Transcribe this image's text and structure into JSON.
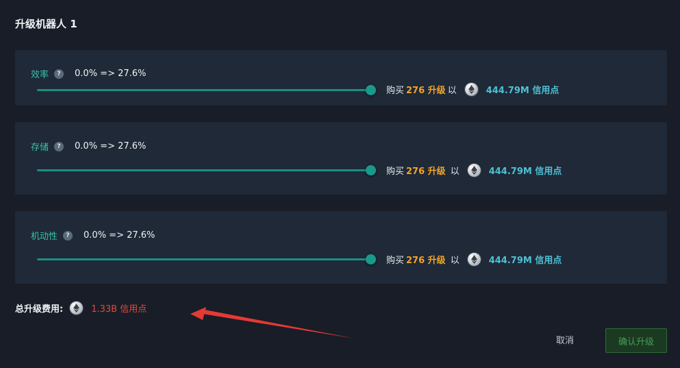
{
  "dialog": {
    "title": "升级机器人 1"
  },
  "upgrades": [
    {
      "name": "效率",
      "change": "0.0% => 27.6%",
      "buy_prefix": "购买",
      "qty": "276 升级",
      "buy_suffix": "以",
      "price": "444.79M 信用点",
      "level_fraction": 1.0
    },
    {
      "name": "存储",
      "change": "0.0% => 27.6%",
      "buy_prefix": "购买",
      "qty": "276 升级",
      "buy_suffix": "以",
      "price": "444.79M 信用点",
      "level_fraction": 1.0
    },
    {
      "name": "机动性",
      "change": "0.0% => 27.6%",
      "buy_prefix": "购买",
      "qty": "276 升级",
      "buy_suffix": "以",
      "price": "444.79M 信用点",
      "level_fraction": 1.0
    }
  ],
  "help_icon": {
    "glyph": "?"
  },
  "total": {
    "label": "总升级费用:",
    "value": "1.33B 信用点"
  },
  "actions": {
    "cancel": "取消",
    "confirm": "确认升级"
  },
  "colors": {
    "accent": "#1a9a8c",
    "qty": "#f3a42a",
    "price": "#4fc0d4",
    "total": "#e44b3d",
    "arrow": "#e53935"
  },
  "icons": {
    "coin": "ethereum-coin-icon",
    "help": "help-circle-icon",
    "annotation": "red-arrow-annotation"
  }
}
